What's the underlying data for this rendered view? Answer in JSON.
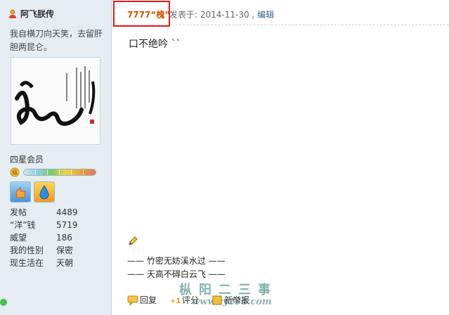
{
  "user": {
    "name": "阿飞朕传",
    "signature": "我自横刀向天笑，去留肝胆两昆仑。",
    "group": "四星会员",
    "stats": [
      {
        "label": "发帖",
        "value": "4489"
      },
      {
        "label": "“洋”钱",
        "value": "5719"
      },
      {
        "label": "威望",
        "value": "186"
      },
      {
        "label": "我的性别",
        "value": "保密"
      },
      {
        "label": "现生活在",
        "value": "天朝"
      }
    ]
  },
  "post": {
    "author": "7777“槐”",
    "posted_prefix": "发表于: 2014-11-30 ,",
    "edit_label": "编辑",
    "content": "口不绝吟 ``",
    "signature_lines": [
      "—— 竹密无妨溪水过 ——",
      "—— 天高不碍白云飞 ——"
    ]
  },
  "actions": {
    "reply": "回复",
    "rate": "评分",
    "report": "新举报"
  },
  "watermark": {
    "title": "枞阳二三事",
    "url": "www.zy234.com"
  },
  "colors": {
    "sidebar_bg": "#e5edf2",
    "author": "#d35400",
    "highlight": "#e01c1c",
    "link": "#336699"
  }
}
